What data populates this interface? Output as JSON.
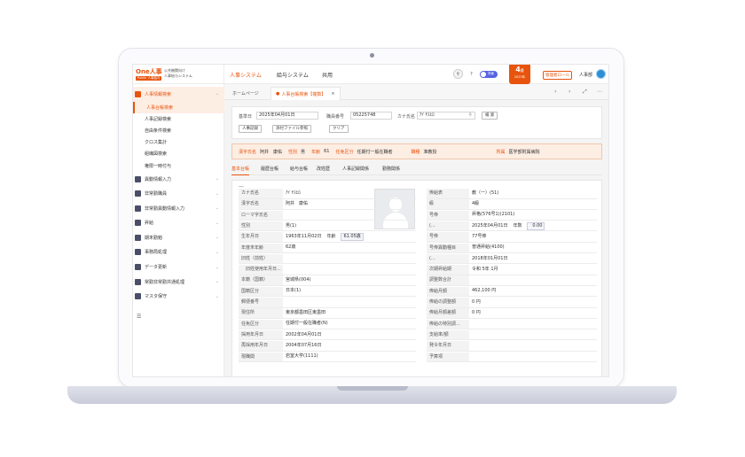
{
  "logo": {
    "main": "One人事",
    "sub": "Public 人事給与",
    "line1": "公共機関向け",
    "line2": "人事給与システム"
  },
  "sidebar": {
    "items": [
      {
        "label": "人事情報検索",
        "active": true,
        "subs": [
          "人事台帳検索",
          "人事記録検索",
          "自由条件検索",
          "クロス集計",
          "組織図検索",
          "権限一時付与"
        ]
      },
      {
        "label": "異動情報入力"
      },
      {
        "label": "非常勤職員"
      },
      {
        "label": "非常勤異動情報入力"
      },
      {
        "label": "昇給"
      },
      {
        "label": "期末勤勉"
      },
      {
        "label": "事務局処理"
      },
      {
        "label": "データ更新"
      },
      {
        "label": "常勤非常勤共通処理"
      },
      {
        "label": "マスタ保守"
      }
    ],
    "footer_icon": "☰"
  },
  "topbar": {
    "tabs": [
      "人事システム",
      "給与システム",
      "共用"
    ],
    "toggle_label": "背景",
    "badge_num": "4",
    "badge_unit": "月",
    "badge_year": "2025年",
    "role": "管理者ロール",
    "user": "人事部"
  },
  "page_tabs": [
    "ホームページ",
    "人事台帳検索【複数】"
  ],
  "page_nav": [
    "‹",
    "›",
    "⤢",
    "⋯"
  ],
  "search": {
    "date_label": "基準日",
    "date_value": "2025年04月01日",
    "staff_label": "職員番号",
    "staff_value": "05225748",
    "kana_label": "カナ氏名",
    "kana_value": "ｱｲ ﾔｽﾋﾛ",
    "search_btn": "検 索",
    "btn_record": "人事記録",
    "btn_attach": "添付ファイル参照",
    "btn_clear": "クリア"
  },
  "info": [
    {
      "k": "漢字氏名",
      "v": "阿井　康佑"
    },
    {
      "k": "性別",
      "v": "男"
    },
    {
      "k": "年齢",
      "v": "61"
    },
    {
      "k": "任免区分",
      "v": "任期付一般在職者"
    },
    {
      "k": "職種",
      "v": "准教授"
    },
    {
      "k": "所属",
      "v": "医学部附属病院"
    }
  ],
  "detail_tabs": [
    "基本台帳",
    "履歴台帳",
    "給与台帳",
    "改姓歴",
    "人事記録関係",
    "勤務関係"
  ],
  "panel_dash": "—",
  "left_rows": [
    {
      "k": "カナ氏名",
      "v": "ｱｲ ﾔｽﾋﾛ"
    },
    {
      "k": "漢字氏名",
      "v": "阿井　康佑"
    },
    {
      "k": "ローマ字氏名",
      "v": ""
    },
    {
      "k": "性別",
      "v": "男(1)"
    },
    {
      "k": "生年月日",
      "v": "1963年11月02日",
      "extra_label": "年齢",
      "extra_value": "61.05歳"
    },
    {
      "k": "年度末年齢",
      "v": "62歳"
    },
    {
      "k": "旧姓（前姓）",
      "v": ""
    },
    {
      "k": "　旧姓使用年月日...",
      "v": ""
    },
    {
      "k": "本籍（国籍）",
      "v": "宮城県(004)"
    },
    {
      "k": "国籍区分",
      "v": "日本(1)"
    },
    {
      "k": "郵便番号",
      "v": ""
    },
    {
      "k": "現住所",
      "v": "東京都墨田区東墨田"
    },
    {
      "k": "任免区分",
      "v": "任期付一般在職者(N)"
    },
    {
      "k": "採用年月日",
      "v": "2002年04月01日"
    },
    {
      "k": "再採用年月日",
      "v": "2004年07月16日"
    },
    {
      "k": "現職関",
      "v": "岩室大学(1111)"
    }
  ],
  "right_rows": [
    {
      "k": "俸給表",
      "v": "教（一）(51)"
    },
    {
      "k": "級",
      "v": "4級"
    },
    {
      "k": "号俸",
      "v": "昇格(576号1)(2101)"
    },
    {
      "k": "(...",
      "v": "2025年04月01日",
      "extra_label": "年数",
      "extra_value": "0.00"
    },
    {
      "k": "号俸",
      "v": "77号俸"
    },
    {
      "k": "号俸異動種目",
      "v": "普通昇給(4100)"
    },
    {
      "k": "(...",
      "v": "2018年01月01日"
    },
    {
      "k": "次期昇給期",
      "v": "令和 5年 1月"
    },
    {
      "k": "調整数合計",
      "v": ""
    },
    {
      "k": "俸給月額",
      "v": "462,100 円"
    },
    {
      "k": "俸給の調整額",
      "v": "0 円"
    },
    {
      "k": "俸給月額差額",
      "v": "0 円"
    },
    {
      "k": "俸給の特別調...",
      "v": ""
    },
    {
      "k": "支給率/額",
      "v": ""
    },
    {
      "k": "発令年月日",
      "v": ""
    },
    {
      "k": "予算項",
      "v": ""
    }
  ]
}
